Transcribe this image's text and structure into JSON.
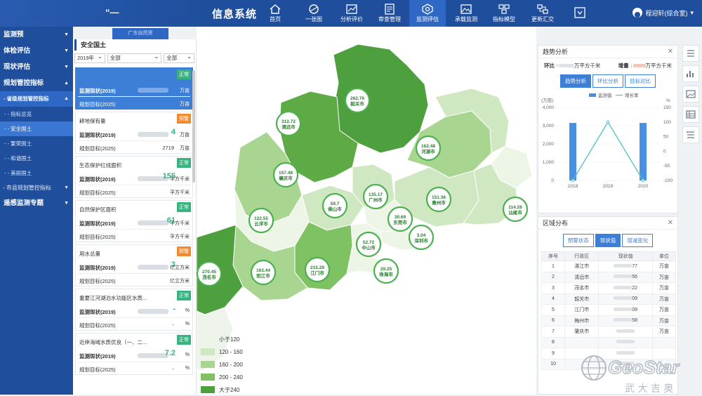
{
  "header": {
    "logo_text": "“—",
    "title": "信息系统",
    "sub_tab": "广东自然资",
    "user_name": "程迎轩(综合室)"
  },
  "nav": [
    {
      "label": "首页",
      "icon": "home-icon"
    },
    {
      "label": "一张图",
      "icon": "globe-icon"
    },
    {
      "label": "分析评价",
      "icon": "chart-icon"
    },
    {
      "label": "审查管理",
      "icon": "document-icon"
    },
    {
      "label": "监测评估",
      "icon": "monitor-icon"
    },
    {
      "label": "承载监测",
      "icon": "image-icon"
    },
    {
      "label": "指标模型",
      "icon": "model-icon"
    },
    {
      "label": "更新汇交",
      "icon": "update-icon"
    },
    {
      "label": "",
      "icon": "dropdown-icon"
    }
  ],
  "sidebar": {
    "items": [
      {
        "label": "监测预",
        "type": "item"
      },
      {
        "label": "体检评估",
        "type": "item"
      },
      {
        "label": "现状评估",
        "type": "item"
      },
      {
        "label": "规划管控指标",
        "type": "item-open"
      },
      {
        "label": "- 省级规划管控指标",
        "type": "lvl2"
      },
      {
        "label": "- - 指标总览",
        "type": "sub"
      },
      {
        "label": "- - 安全国土",
        "type": "sub-active"
      },
      {
        "label": "- - 繁荣国土",
        "type": "sub"
      },
      {
        "label": "- - 和谐国土",
        "type": "sub"
      },
      {
        "label": "- - 美丽国土",
        "type": "sub"
      },
      {
        "label": "- 市县规划管控指标",
        "type": "lvl2"
      },
      {
        "label": "遥感监测专题",
        "type": "item"
      }
    ]
  },
  "panel": {
    "title": "安全国土",
    "year": "2019年",
    "filter2": "全部",
    "filter3": "全部",
    "cards": [
      {
        "name": "",
        "badge": "正常",
        "badge_type": "ok",
        "row1": "监测现状(2019)",
        "value1": "",
        "unit1": "万亩",
        "row2": "规划目标(2025)",
        "value2": "",
        "unit2": "万亩"
      },
      {
        "name": "耕地保有量",
        "badge": "预警",
        "badge_type": "warn",
        "row1": "监测现状(2019)",
        "value1": "4",
        "unit1": "万亩",
        "row2": "规划目标(2025)",
        "value2": "2719",
        "unit2": "万亩"
      },
      {
        "name": "生态保护红线面积",
        "badge": "正常",
        "badge_type": "ok",
        "row1": "监测现状(2019)",
        "value1": "155",
        "unit1": "平方千米",
        "row2": "规划目标(2025)",
        "value2": "-",
        "unit2": "平方千米"
      },
      {
        "name": "自然保护区面积",
        "badge": "正常",
        "badge_type": "ok",
        "row1": "监测现状(2019)",
        "value1": "61",
        "unit1": "平方千米",
        "row2": "规划目标(2025)",
        "value2": "-",
        "unit2": "平方千米"
      },
      {
        "name": "用水总量",
        "badge": "预警",
        "badge_type": "warn",
        "row1": "监测现状(2019)",
        "value1": "3",
        "unit1": "亿立方米",
        "row2": "规划目标(2025)",
        "value2": "",
        "unit2": "亿立方米"
      },
      {
        "name": "重要江河湖泊水功能区水质...",
        "badge": "正常",
        "badge_type": "ok",
        "row1": "监测现状(2019)",
        "value1": "-",
        "unit1": "%",
        "row2": "规划目标(2025)",
        "value2": "-",
        "unit2": "%"
      },
      {
        "name": "近岸海域水质优良（一、二...",
        "badge": "正常",
        "badge_type": "ok",
        "row1": "监测现状(2019)",
        "value1": "7.2",
        "unit1": "%",
        "row2": "规划目标(2025)",
        "value2": "-",
        "unit2": "%"
      }
    ]
  },
  "map": {
    "bubbles": [
      {
        "value": "262.76",
        "city": "韶关市"
      },
      {
        "value": "312.72",
        "city": "清远市"
      },
      {
        "value": "162.48",
        "city": "河源市"
      },
      {
        "value": "157.48",
        "city": "肇庆市"
      },
      {
        "value": "135.17",
        "city": "广州市"
      },
      {
        "value": "59.7",
        "city": "佛山市"
      },
      {
        "value": "151.36",
        "city": "惠州市"
      },
      {
        "value": "114.28",
        "city": "汕尾市"
      },
      {
        "value": "122.55",
        "city": "云浮市"
      },
      {
        "value": "30.69",
        "city": "东莞市"
      },
      {
        "value": "3.04",
        "city": "深圳市"
      },
      {
        "value": "52.72",
        "city": "中山市"
      },
      {
        "value": "270.45",
        "city": "茂名市"
      },
      {
        "value": "163.44",
        "city": "阳江市"
      },
      {
        "value": "215.29",
        "city": "江门市"
      },
      {
        "value": "29.25",
        "city": "珠海市"
      }
    ],
    "legend": [
      {
        "label": "小于120",
        "color": "#edf6e6"
      },
      {
        "label": "120 - 160",
        "color": "#cfe8c2"
      },
      {
        "label": "160 - 200",
        "color": "#a8d690"
      },
      {
        "label": "200 - 240",
        "color": "#7fc264"
      },
      {
        "label": "大于240",
        "color": "#4e9f3d"
      }
    ]
  },
  "trend": {
    "title": "趋势分析",
    "huanbi_label": "环比",
    "huanbi_unit": "万平方千米",
    "zengliang_label": "增量",
    "zengliang_unit": "万平方千米",
    "tabs": [
      "趋势分析",
      "环比分析",
      "目标对比"
    ],
    "legend_bar": "监测值",
    "legend_line": "增长率",
    "left_unit": "(万亩)",
    "right_unit": "%"
  },
  "chart_data": {
    "type": "bar",
    "categories": [
      "2018",
      "2019",
      "2020"
    ],
    "series": [
      {
        "name": "监测值",
        "type": "bar",
        "values": [
          3150,
          3150,
          3150
        ]
      },
      {
        "name": "增长率",
        "type": "line",
        "values": [
          -100,
          100,
          -100
        ]
      }
    ],
    "ylim_left": [
      0,
      4000
    ],
    "yticks_left": [
      "4,000",
      "3,000",
      "2,000",
      "1,000",
      "0"
    ],
    "ylim_right": [
      -100,
      150
    ],
    "yticks_right": [
      "150",
      "100",
      "50",
      "0",
      "-50",
      "-100"
    ]
  },
  "region": {
    "title": "区域分布",
    "tabs": [
      "预警状态",
      "现状值",
      "增减变化"
    ],
    "columns": [
      "序号",
      "行政区",
      "现状值",
      "单位"
    ],
    "rows": [
      {
        "no": "1",
        "name": "湛江市",
        "value": "77",
        "unit": "万亩"
      },
      {
        "no": "2",
        "name": "清远市",
        "value": "56",
        "unit": "万亩"
      },
      {
        "no": "3",
        "name": "茂名市",
        "value": "22",
        "unit": "万亩"
      },
      {
        "no": "4",
        "name": "韶关市",
        "value": "09",
        "unit": "万亩"
      },
      {
        "no": "5",
        "name": "江门市",
        "value": "09",
        "unit": "万亩"
      },
      {
        "no": "6",
        "name": "梅州市",
        "value": "58",
        "unit": "万亩"
      },
      {
        "no": "7",
        "name": "肇庆市",
        "value": "",
        "unit": "万亩"
      },
      {
        "no": "8",
        "name": "",
        "value": "",
        "unit": ""
      },
      {
        "no": "9",
        "name": "",
        "value": "",
        "unit": ""
      },
      {
        "no": "10",
        "name": "",
        "value": "",
        "unit": ""
      }
    ]
  },
  "watermark": {
    "brand": "GeoStar",
    "brand_cn": "武 大 吉 奥"
  }
}
